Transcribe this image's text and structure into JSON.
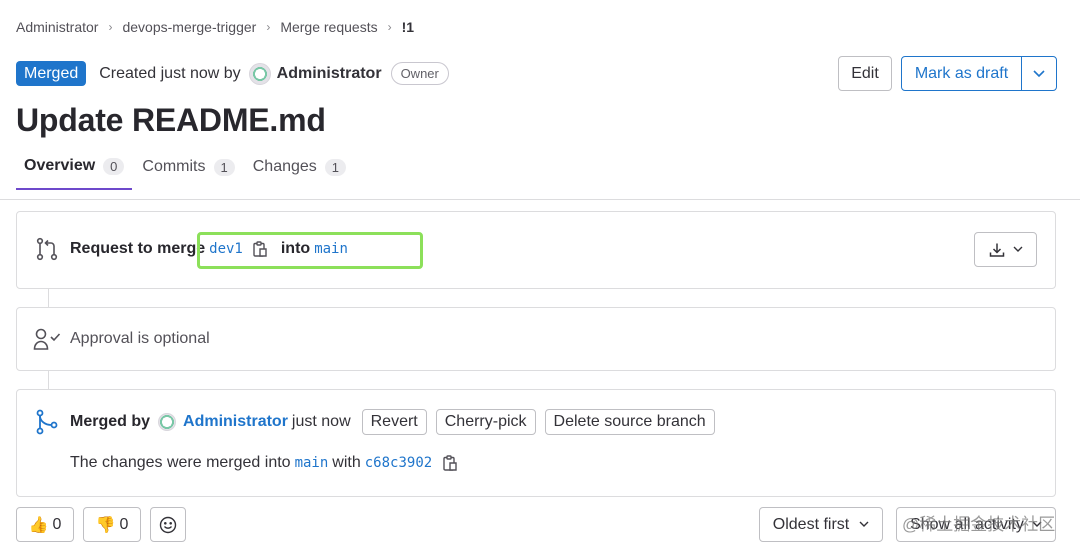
{
  "breadcrumb": [
    "Administrator",
    "devops-merge-trigger",
    "Merge requests",
    "!1"
  ],
  "header": {
    "status": "Merged",
    "created_text": "Created just now by",
    "author": "Administrator",
    "role": "Owner",
    "edit_label": "Edit",
    "draft_label": "Mark as draft"
  },
  "title": "Update README.md",
  "tabs": [
    {
      "label": "Overview",
      "count": "0"
    },
    {
      "label": "Commits",
      "count": "1"
    },
    {
      "label": "Changes",
      "count": "1"
    }
  ],
  "request": {
    "label": "Request to merge",
    "source": "dev1",
    "into": "into",
    "target": "main"
  },
  "approval": {
    "text": "Approval is optional"
  },
  "merged": {
    "label": "Merged by",
    "author": "Administrator",
    "when": "just now",
    "revert": "Revert",
    "cherry_pick": "Cherry-pick",
    "delete_branch": "Delete source branch",
    "message_prefix": "The changes were merged into",
    "branch": "main",
    "with": "with",
    "commit": "c68c3902"
  },
  "reactions": {
    "thumbs_up": "0",
    "thumbs_down": "0"
  },
  "sort": {
    "order": "Oldest first",
    "filter": "Show all activity"
  },
  "watermark": "@稀土掘金技术社区",
  "colors": {
    "accent": "#1f75cb",
    "active_tab": "#6e49cb",
    "highlight": "#8ce05a"
  }
}
